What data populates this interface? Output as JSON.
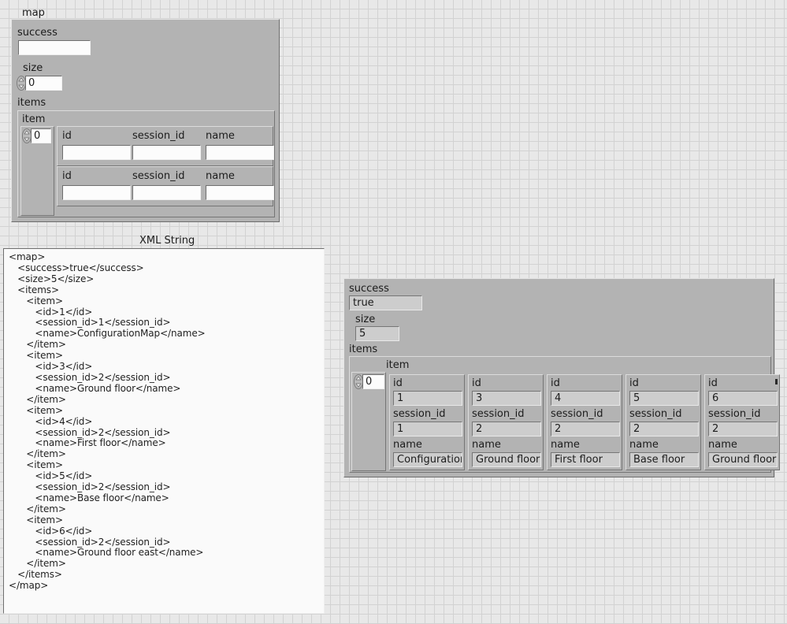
{
  "control_cluster": {
    "title": "map",
    "success_label": "success",
    "success_value": "",
    "size_label": "size",
    "size_value": "0",
    "items_label": "items",
    "item_label": "item",
    "index_value": "0",
    "columns": [
      "id",
      "session_id",
      "name"
    ],
    "rows": [
      {
        "id": "",
        "session_id": "",
        "name": ""
      },
      {
        "id": "",
        "session_id": "",
        "name": ""
      }
    ]
  },
  "xml_panel": {
    "title": "XML String",
    "content": "<map>\n   <success>true</success>\n   <size>5</size>\n   <items>\n      <item>\n         <id>1</id>\n         <session_id>1</session_id>\n         <name>ConfigurationMap</name>\n      </item>\n      <item>\n         <id>3</id>\n         <session_id>2</session_id>\n         <name>Ground floor</name>\n      </item>\n      <item>\n         <id>4</id>\n         <session_id>2</session_id>\n         <name>First floor</name>\n      </item>\n      <item>\n         <id>5</id>\n         <session_id>2</session_id>\n         <name>Base floor</name>\n      </item>\n      <item>\n         <id>6</id>\n         <session_id>2</session_id>\n         <name>Ground floor east</name>\n      </item>\n   </items>\n</map>"
  },
  "indicator_cluster": {
    "success_label": "success",
    "success_value": "true",
    "size_label": "size",
    "size_value": "5",
    "items_label": "items",
    "item_label": "item",
    "index_value": "0",
    "field_labels": {
      "id": "id",
      "session_id": "session_id",
      "name": "name"
    },
    "elements": [
      {
        "id": "1",
        "session_id": "1",
        "name": "ConfigurationM"
      },
      {
        "id": "3",
        "session_id": "2",
        "name": "Ground floor"
      },
      {
        "id": "4",
        "session_id": "2",
        "name": "First floor"
      },
      {
        "id": "5",
        "session_id": "2",
        "name": "Base floor"
      },
      {
        "id": "6",
        "session_id": "2",
        "name": "Ground floor"
      }
    ]
  },
  "colors": {
    "panel": "#b3b3b3",
    "control_field": "#fcfcfc",
    "indicator_field": "#cdcdcd",
    "background": "#e8e8e8",
    "grid_line": "#d2d2d2",
    "text": "#1c1c1c"
  }
}
